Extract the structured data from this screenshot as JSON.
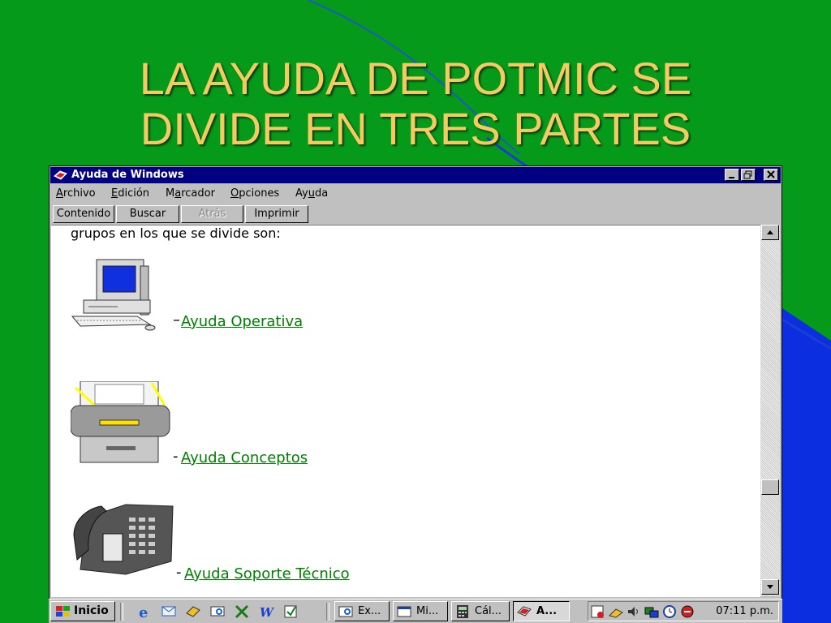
{
  "slide": {
    "title_line1": "LA AYUDA DE POTMIC SE",
    "title_line2": "DIVIDE EN TRES PARTES",
    "colors": {
      "background": "#069a1a",
      "title": "#f2cc63",
      "accent_blue": "#0a2ee0"
    }
  },
  "window": {
    "title": "Ayuda de Windows",
    "controls": [
      "minimize-icon",
      "restore-icon",
      "close-icon"
    ]
  },
  "menu": {
    "items": [
      {
        "pre": "",
        "key": "A",
        "post": "rchivo"
      },
      {
        "pre": "",
        "key": "E",
        "post": "dición"
      },
      {
        "pre": "M",
        "key": "a",
        "post": "rcador"
      },
      {
        "pre": "",
        "key": "O",
        "post": "pciones"
      },
      {
        "pre": "Ay",
        "key": "u",
        "post": "da"
      }
    ]
  },
  "toolbar": {
    "contents": "Contenido",
    "search": "Buscar",
    "back": "Atrás",
    "print": "Imprimir"
  },
  "content": {
    "intro": "grupos en los que se divide son:",
    "link_color": "#008000",
    "items": [
      {
        "icon": "computer-icon",
        "dash": "–",
        "label": "Ayuda Operativa"
      },
      {
        "icon": "printer-icon",
        "dash": "-",
        "label": "Ayuda Conceptos "
      },
      {
        "icon": "telephone-icon",
        "dash": "-",
        "label": "Ayuda Soporte Técnico"
      }
    ]
  },
  "taskbar": {
    "start": "Inicio",
    "quick_launch": [
      "internet-explorer-icon",
      "outlook-express-icon",
      "channels-icon",
      "explorer-icon",
      "excel-icon",
      "word-icon",
      "note-icon"
    ],
    "tasks": [
      {
        "label": "Ex...",
        "icon": "explorer-icon",
        "active": false
      },
      {
        "label": "Mi...",
        "icon": "window-icon",
        "active": false
      },
      {
        "label": "Cál...",
        "icon": "calculator-icon",
        "active": false
      },
      {
        "label": "A...",
        "icon": "help-book-icon",
        "active": true
      }
    ],
    "tray_icons": [
      "scheduler-icon",
      "satellite-icon",
      "volume-icon",
      "network-icon",
      "time-icon",
      "antivirus-icon"
    ],
    "clock": "07:11 p.m."
  }
}
